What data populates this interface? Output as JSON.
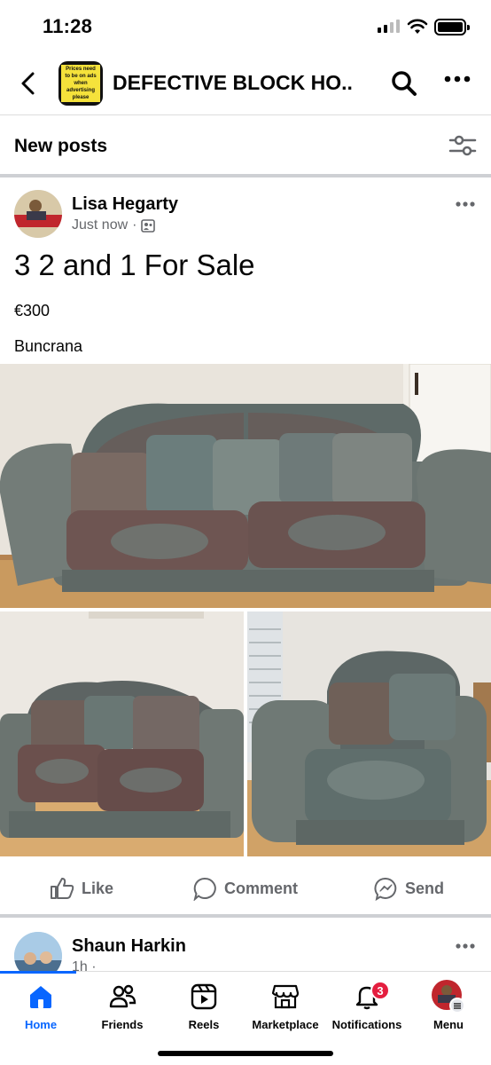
{
  "status_bar": {
    "time": "11:28"
  },
  "header": {
    "group_name": "DEFECTIVE BLOCK HO...",
    "group_avatar_text": "Prices need to be on ads when advertising please"
  },
  "feed": {
    "section_title": "New posts"
  },
  "post": {
    "author": "Lisa Hegarty",
    "time": "Just now",
    "separator": "·",
    "title": "3 2 and 1 For Sale",
    "price": "€300",
    "location": "Buncrana",
    "actions": {
      "like": "Like",
      "comment": "Comment",
      "send": "Send"
    }
  },
  "next_post": {
    "author": "Shaun Harkin",
    "time": "1h",
    "separator": "·"
  },
  "bottom_nav": {
    "items": [
      {
        "label": "Home",
        "icon": "home-icon",
        "active": true
      },
      {
        "label": "Friends",
        "icon": "friends-icon"
      },
      {
        "label": "Reels",
        "icon": "reels-icon"
      },
      {
        "label": "Marketplace",
        "icon": "marketplace-icon"
      },
      {
        "label": "Notifications",
        "icon": "bell-icon",
        "badge": "3"
      },
      {
        "label": "Menu",
        "icon": "menu-avatar-icon"
      }
    ]
  },
  "colors": {
    "accent": "#0866ff",
    "badge": "#e41e3f",
    "secondary_text": "#65676b",
    "separator": "#ced0d4"
  }
}
